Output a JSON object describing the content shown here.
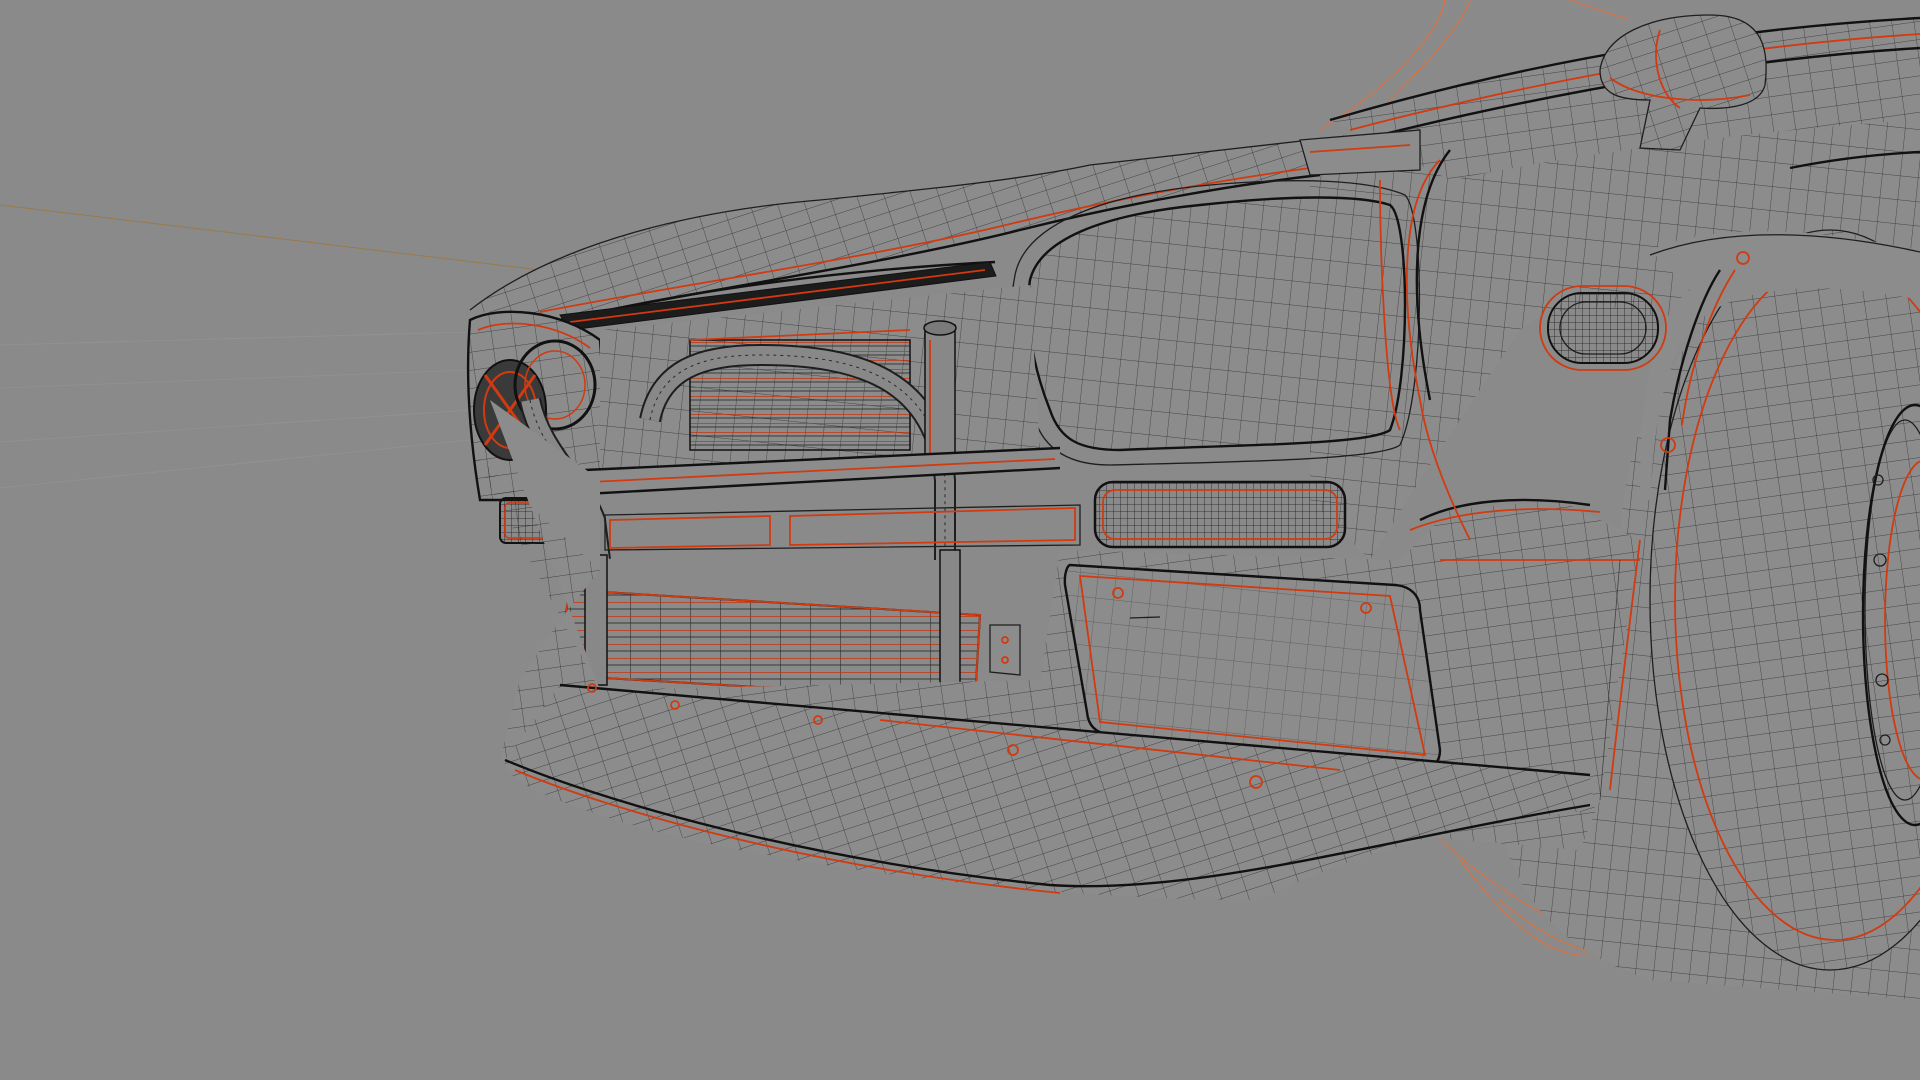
{
  "viewport": {
    "background_color": "#8a8a8a",
    "wire_color": "#1e1e1e",
    "selected_edge_color": "#d23a10",
    "curve_color": "#e0703a",
    "x_axis_color": "#9a7a4a",
    "object": "car-front-wireframe"
  }
}
